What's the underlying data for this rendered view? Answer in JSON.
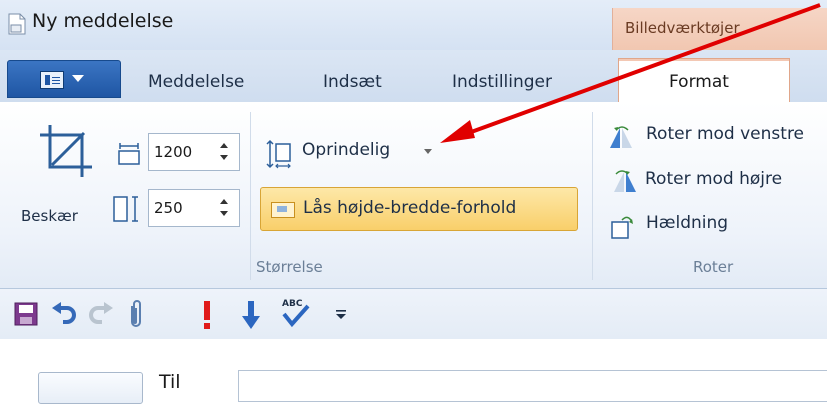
{
  "window": {
    "title": "Ny meddelelse",
    "context_tab_group": "Billedværktøjer"
  },
  "ribbon": {
    "tabs": [
      "Meddelelse",
      "Indsæt",
      "Indstillinger",
      "Format"
    ],
    "active_tab": "Format",
    "size_group": {
      "label": "Størrelse",
      "crop_label": "Beskær",
      "width_value": "1200",
      "height_value": "250",
      "original_size_label": "Oprindelig",
      "lock_aspect_label": "Lås højde-bredde-forhold"
    },
    "rotate_group": {
      "label": "Roter",
      "rotate_left": "Roter mod venstre",
      "rotate_right": "Roter mod højre",
      "skew": "Hældning"
    }
  },
  "quick_access": {
    "icons": [
      "save-icon",
      "undo-icon",
      "redo-icon",
      "attach-icon",
      "high-importance-icon",
      "low-importance-icon",
      "spelling-icon",
      "customize-icon"
    ]
  },
  "compose": {
    "to_label": "Til"
  },
  "colors": {
    "accent_blue": "#1f56a4",
    "context_tab": "#f1c7b1",
    "lock_button": "#f9cf6a",
    "annotation_arrow": "#e00000"
  }
}
